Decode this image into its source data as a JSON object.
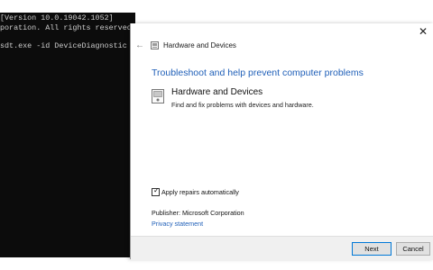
{
  "console": {
    "lines": [
      "[Version 10.0.19042.1052]",
      "poration. All rights reserved.",
      "sdt.exe -id DeviceDiagnostic"
    ]
  },
  "dialog": {
    "title": "Hardware and Devices",
    "headline": "Troubleshoot and help prevent computer problems",
    "item": {
      "title": "Hardware and Devices",
      "description": "Find and fix problems with devices and hardware."
    },
    "checkbox": {
      "label": "Apply repairs automatically",
      "checked": true
    },
    "publisher": "Publisher:  Microsoft Corporation",
    "privacy_link": "Privacy statement",
    "buttons": {
      "next": "Next",
      "cancel": "Cancel"
    }
  },
  "icons": {
    "close": "close-icon",
    "back": "back-arrow-icon",
    "title": "hardware-devices-icon",
    "item": "troubleshooter-icon"
  },
  "colors": {
    "link": "#1f5fb8",
    "console_bg": "#0c0c0c",
    "primary_border": "#0078d7"
  }
}
